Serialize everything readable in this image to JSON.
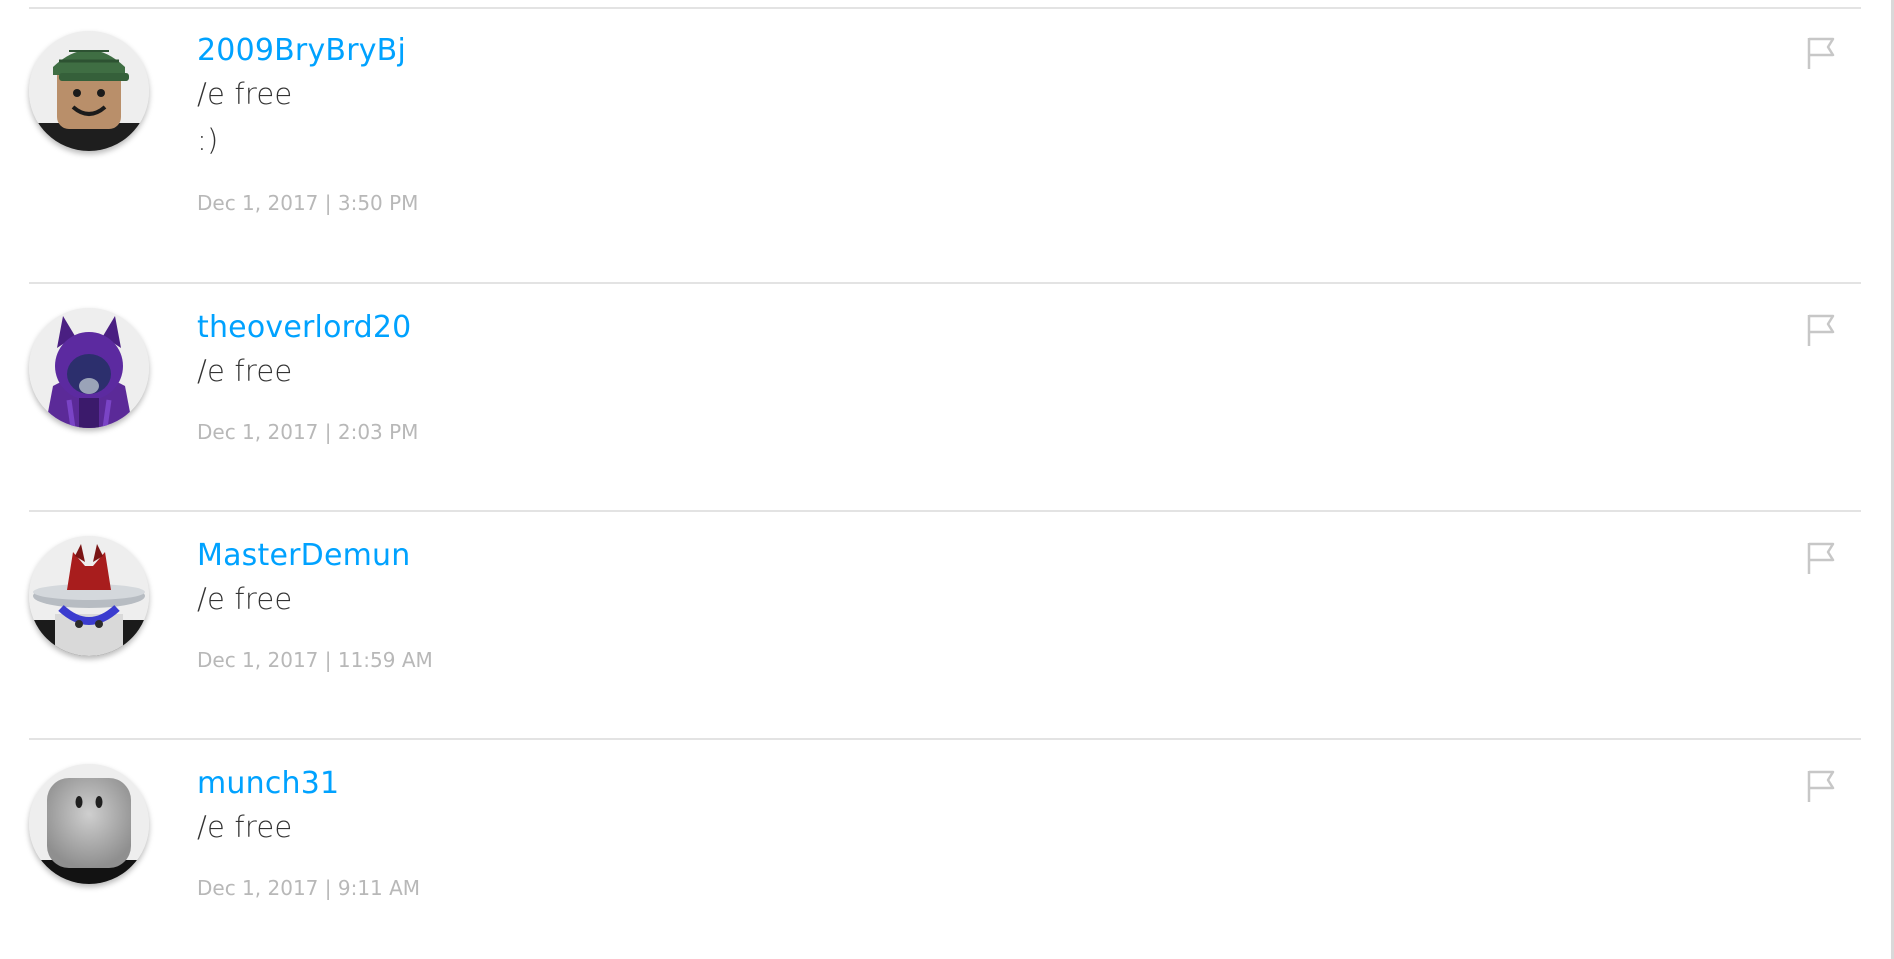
{
  "comments": [
    {
      "username": "2009BryBryBj",
      "lines": [
        "/e free",
        ":)"
      ],
      "timestamp": "Dec 1, 2017 | 3:50 PM",
      "avatar_icon": "avatar-green-cap-icon",
      "flag_icon": "flag-icon"
    },
    {
      "username": "theoverlord20",
      "lines": [
        "/e free"
      ],
      "timestamp": "Dec 1, 2017 | 2:03 PM",
      "avatar_icon": "avatar-purple-hood-icon",
      "flag_icon": "flag-icon"
    },
    {
      "username": "MasterDemun",
      "lines": [
        "/e free"
      ],
      "timestamp": "Dec 1, 2017 | 11:59 AM",
      "avatar_icon": "avatar-ufo-hat-icon",
      "flag_icon": "flag-icon"
    },
    {
      "username": "munch31",
      "lines": [
        "/e free"
      ],
      "timestamp": "Dec 1, 2017 | 9:11 AM",
      "avatar_icon": "avatar-gray-head-icon",
      "flag_icon": "flag-icon"
    }
  ],
  "colors": {
    "username": "#00a2ff",
    "body_text": "#333333",
    "timestamp": "#b8b8b8",
    "divider": "#e3e3e3",
    "flag": "#c7c7c7"
  }
}
